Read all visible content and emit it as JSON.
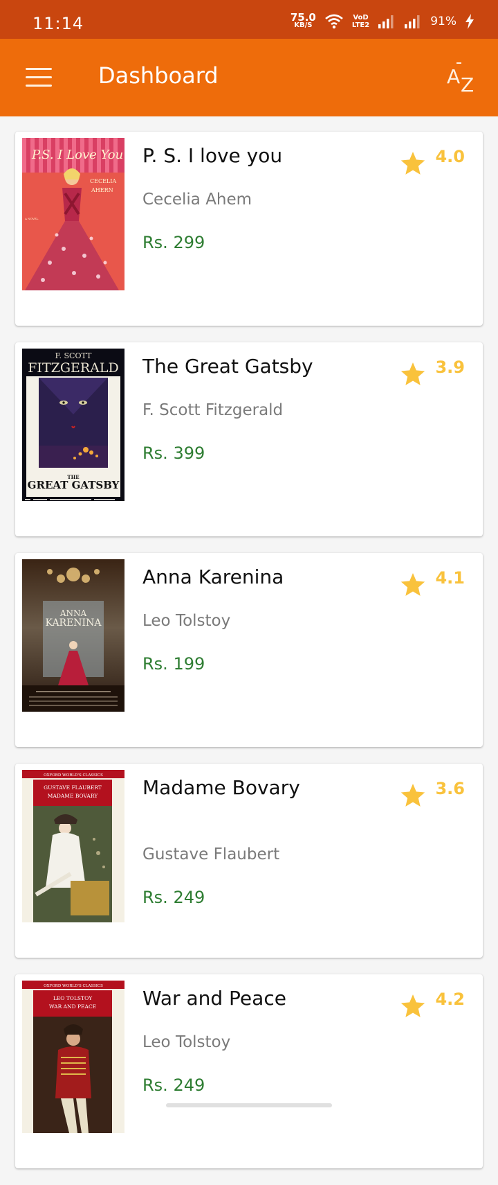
{
  "status_bar": {
    "time": "11:14",
    "net_speed_value": "75.0",
    "net_speed_unit": "KB/S",
    "volte_top": "VoD",
    "volte_bottom": "LTE2",
    "battery": "91%"
  },
  "app_bar": {
    "title": "Dashboard",
    "menu_icon": "hamburger-menu-icon",
    "sort_icon": "sort-az-icon"
  },
  "colors": {
    "status_bar": "#c9460f",
    "app_bar": "#ee6c0b",
    "price": "#2e7d32",
    "rating": "#f9c23c"
  },
  "books": [
    {
      "title": "P. S.  I love you",
      "author": "Cecelia Ahem",
      "price": "Rs.  299",
      "rating": "4.0",
      "cover_text": [
        "P.S. I Love You",
        "CECELIA",
        "AHERN",
        "A NOVEL"
      ]
    },
    {
      "title": "The Great Gatsby",
      "author": "F. Scott Fitzgerald",
      "price": "Rs.  399",
      "rating": "3.9",
      "cover_text": [
        "F. SCOTT",
        "FITZGERALD",
        "THE",
        "GREAT GATSBY"
      ]
    },
    {
      "title": "Anna Karenina",
      "author": "Leo Tolstoy",
      "price": "Rs.  199",
      "rating": "4.1",
      "cover_text": [
        "ANNA",
        "KARENINA"
      ]
    },
    {
      "title": "Madame Bovary",
      "author": "Gustave Flaubert",
      "price": "Rs.  249",
      "rating": "3.6",
      "cover_text": [
        "OXFORD WORLD'S CLASSICS",
        "GUSTAVE FLAUBERT",
        "MADAME BOVARY"
      ]
    },
    {
      "title": "War and Peace",
      "author": "Leo Tolstoy",
      "price": "Rs.  249",
      "rating": "4.2",
      "cover_text": [
        "OXFORD WORLD'S CLASSICS",
        "LEO TOLSTOY",
        "WAR AND PEACE"
      ]
    }
  ]
}
